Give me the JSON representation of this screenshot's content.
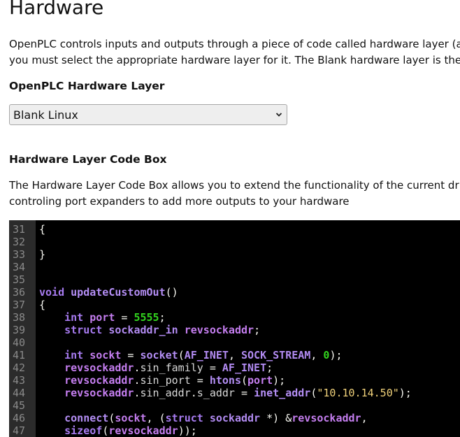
{
  "page": {
    "title": "Hardware",
    "intro_lines": [
      "OpenPLC controls inputs and outputs through a piece of code called hardware layer (a",
      "you must select the appropriate hardware layer for it. The Blank hardware layer is the"
    ]
  },
  "hardware_layer": {
    "heading": "OpenPLC Hardware Layer",
    "selected": "Blank Linux"
  },
  "code_box": {
    "heading": "Hardware Layer Code Box",
    "description_lines": [
      "The Hardware Layer Code Box allows you to extend the functionality of the current dr",
      "controling port expanders to add more outputs to your hardware"
    ]
  },
  "editor": {
    "colors": {
      "background": "#000000",
      "gutter": "#2b2b2b",
      "keyword": "#a77bf0",
      "number": "#32d41e",
      "string": "#f0d17a"
    },
    "lines": [
      {
        "n": "31",
        "tokens": [
          {
            "t": "{",
            "c": "op"
          }
        ]
      },
      {
        "n": "32",
        "tokens": []
      },
      {
        "n": "33",
        "tokens": [
          {
            "t": "}",
            "c": "op"
          }
        ]
      },
      {
        "n": "34",
        "tokens": []
      },
      {
        "n": "35",
        "tokens": []
      },
      {
        "n": "36",
        "tokens": [
          {
            "t": "void",
            "c": "kw"
          },
          {
            "t": " ",
            "c": "op"
          },
          {
            "t": "updateCustomOut",
            "c": "fn"
          },
          {
            "t": "()",
            "c": "op"
          }
        ]
      },
      {
        "n": "37",
        "tokens": [
          {
            "t": "{",
            "c": "op"
          }
        ]
      },
      {
        "n": "38",
        "tokens": [
          {
            "t": "    ",
            "c": "op"
          },
          {
            "t": "int",
            "c": "kw"
          },
          {
            "t": " ",
            "c": "op"
          },
          {
            "t": "port",
            "c": "var"
          },
          {
            "t": " = ",
            "c": "op"
          },
          {
            "t": "5555",
            "c": "num"
          },
          {
            "t": ";",
            "c": "op"
          }
        ]
      },
      {
        "n": "39",
        "tokens": [
          {
            "t": "    ",
            "c": "op"
          },
          {
            "t": "struct",
            "c": "kw"
          },
          {
            "t": " ",
            "c": "op"
          },
          {
            "t": "sockaddr_in",
            "c": "ty"
          },
          {
            "t": " ",
            "c": "op"
          },
          {
            "t": "revsockaddr",
            "c": "var"
          },
          {
            "t": ";",
            "c": "op"
          }
        ]
      },
      {
        "n": "40",
        "tokens": []
      },
      {
        "n": "41",
        "tokens": [
          {
            "t": "    ",
            "c": "op"
          },
          {
            "t": "int",
            "c": "kw"
          },
          {
            "t": " ",
            "c": "op"
          },
          {
            "t": "sockt",
            "c": "var"
          },
          {
            "t": " = ",
            "c": "op"
          },
          {
            "t": "socket",
            "c": "fn"
          },
          {
            "t": "(",
            "c": "op"
          },
          {
            "t": "AF_INET",
            "c": "const"
          },
          {
            "t": ", ",
            "c": "op"
          },
          {
            "t": "SOCK_STREAM",
            "c": "const"
          },
          {
            "t": ", ",
            "c": "op"
          },
          {
            "t": "0",
            "c": "num"
          },
          {
            "t": ");",
            "c": "op"
          }
        ]
      },
      {
        "n": "42",
        "tokens": [
          {
            "t": "    ",
            "c": "op"
          },
          {
            "t": "revsockaddr",
            "c": "var"
          },
          {
            "t": ".",
            "c": "op"
          },
          {
            "t": "sin_family",
            "c": "plain"
          },
          {
            "t": " = ",
            "c": "op"
          },
          {
            "t": "AF_INET",
            "c": "const"
          },
          {
            "t": ";",
            "c": "op"
          }
        ]
      },
      {
        "n": "43",
        "tokens": [
          {
            "t": "    ",
            "c": "op"
          },
          {
            "t": "revsockaddr",
            "c": "var"
          },
          {
            "t": ".",
            "c": "op"
          },
          {
            "t": "sin_port",
            "c": "plain"
          },
          {
            "t": " = ",
            "c": "op"
          },
          {
            "t": "htons",
            "c": "fn"
          },
          {
            "t": "(",
            "c": "op"
          },
          {
            "t": "port",
            "c": "var"
          },
          {
            "t": ");",
            "c": "op"
          }
        ]
      },
      {
        "n": "44",
        "tokens": [
          {
            "t": "    ",
            "c": "op"
          },
          {
            "t": "revsockaddr",
            "c": "var"
          },
          {
            "t": ".",
            "c": "op"
          },
          {
            "t": "sin_addr",
            "c": "plain"
          },
          {
            "t": ".",
            "c": "op"
          },
          {
            "t": "s_addr",
            "c": "plain"
          },
          {
            "t": " = ",
            "c": "op"
          },
          {
            "t": "inet_addr",
            "c": "fn"
          },
          {
            "t": "(",
            "c": "op"
          },
          {
            "t": "\"10.10.14.50\"",
            "c": "str"
          },
          {
            "t": ");",
            "c": "op"
          }
        ]
      },
      {
        "n": "45",
        "tokens": []
      },
      {
        "n": "46",
        "tokens": [
          {
            "t": "    ",
            "c": "op"
          },
          {
            "t": "connect",
            "c": "fn"
          },
          {
            "t": "(",
            "c": "op"
          },
          {
            "t": "sockt",
            "c": "var"
          },
          {
            "t": ", (",
            "c": "op"
          },
          {
            "t": "struct",
            "c": "kw"
          },
          {
            "t": " ",
            "c": "op"
          },
          {
            "t": "sockaddr",
            "c": "ty"
          },
          {
            "t": " *) &",
            "c": "op"
          },
          {
            "t": "revsockaddr",
            "c": "var"
          },
          {
            "t": ",",
            "c": "op"
          }
        ]
      },
      {
        "n": "47",
        "tokens": [
          {
            "t": "    ",
            "c": "op"
          },
          {
            "t": "sizeof",
            "c": "kw"
          },
          {
            "t": "(",
            "c": "op"
          },
          {
            "t": "revsockaddr",
            "c": "var"
          },
          {
            "t": "));",
            "c": "op"
          }
        ]
      }
    ]
  }
}
